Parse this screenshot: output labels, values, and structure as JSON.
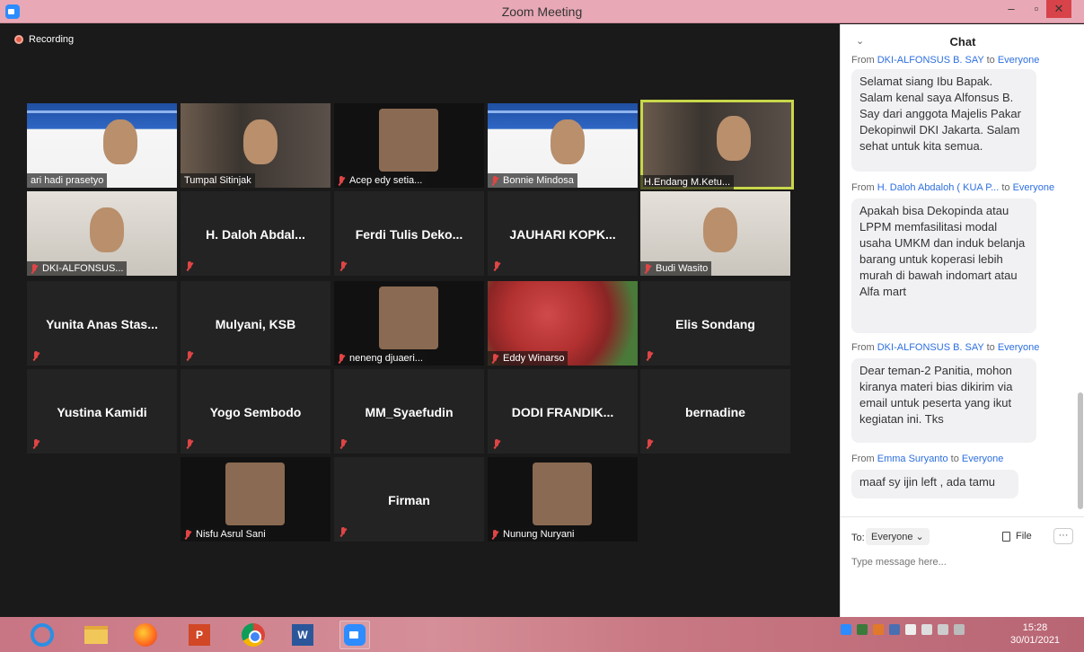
{
  "window": {
    "title": "Zoom Meeting",
    "minimize": "–",
    "maximize": "▫",
    "close": "✕"
  },
  "recording": "Recording",
  "tiles": [
    {
      "name": "ari hadi prasetyo",
      "video": true
    },
    {
      "name": "Tumpal Sitinjak",
      "video": true
    },
    {
      "name": "Acep edy setia...",
      "video": true,
      "muted": true
    },
    {
      "name": "Bonnie Mindosa",
      "video": true,
      "muted": true
    },
    {
      "name": "H.Endang M.Ketu...",
      "video": true,
      "active": true
    },
    {
      "name": "DKI-ALFONSUS...",
      "video": true,
      "muted": true
    },
    {
      "name": "H. Daloh Abdal...",
      "video": false,
      "muted": true
    },
    {
      "name": "Ferdi Tulis Deko...",
      "video": false,
      "muted": true
    },
    {
      "name": "JAUHARI KOPK...",
      "video": false,
      "muted": true
    },
    {
      "name": "Budi Wasito",
      "video": true,
      "muted": true
    },
    {
      "name": "Yunita Anas Stas...",
      "video": false,
      "muted": true
    },
    {
      "name": "Mulyani, KSB",
      "video": false,
      "muted": true
    },
    {
      "name": "neneng djuaeri...",
      "video": true,
      "muted": true
    },
    {
      "name": "Eddy Winarso",
      "video": true,
      "muted": true
    },
    {
      "name": "Elis Sondang",
      "video": false,
      "muted": true
    },
    {
      "name": "Yustina Kamidi",
      "video": false,
      "muted": true
    },
    {
      "name": "Yogo Sembodo",
      "video": false,
      "muted": true
    },
    {
      "name": "MM_Syaefudin",
      "video": false,
      "muted": true
    },
    {
      "name": "DODI FRANDIK...",
      "video": false,
      "muted": true
    },
    {
      "name": "bernadine",
      "video": false,
      "muted": true
    },
    {
      "name": "Nisfu Asrul Sani",
      "video": true,
      "muted": true
    },
    {
      "name": "Firman",
      "video": false,
      "muted": true
    },
    {
      "name": "Nunung Nuryani",
      "video": true,
      "muted": true
    }
  ],
  "chat": {
    "title": "Chat",
    "collapse_icon": "⌄",
    "messages": [
      {
        "from": "DKI-ALFONSUS B. SAY",
        "to": "Everyone",
        "text": "Selamat siang Ibu Bapak. Salam kenal saya Alfonsus B. Say dari anggota Majelis Pakar Dekopinwil DKI Jakarta. Salam sehat untuk kita semua."
      },
      {
        "from": "H. Daloh Abdaloh ( KUA P...",
        "to": "Everyone",
        "text": "Apakah bisa Dekopinda atau LPPM memfasilitasi modal usaha UMKM dan induk belanja barang untuk koperasi  lebih murah di bawah indomart atau Alfa mart"
      },
      {
        "from": "DKI-ALFONSUS B. SAY",
        "to": "Everyone",
        "text": "Dear teman-2 Panitia, mohon kiranya materi bias dikirim via email untuk peserta yang ikut kegiatan ini. Tks"
      },
      {
        "from": "Emma Suryanto",
        "to": "Everyone",
        "text": "maaf sy ijin left , ada tamu"
      }
    ],
    "from_word": "From",
    "to_word": "to",
    "to_label": "To:",
    "recipient": "Everyone ⌄",
    "file_label": "File",
    "more_label": "···",
    "input_placeholder": "Type message here..."
  },
  "taskbar": {
    "ppt_label": "P",
    "word_label": "W",
    "clock_time": "15:28",
    "clock_date": "30/01/2021"
  }
}
